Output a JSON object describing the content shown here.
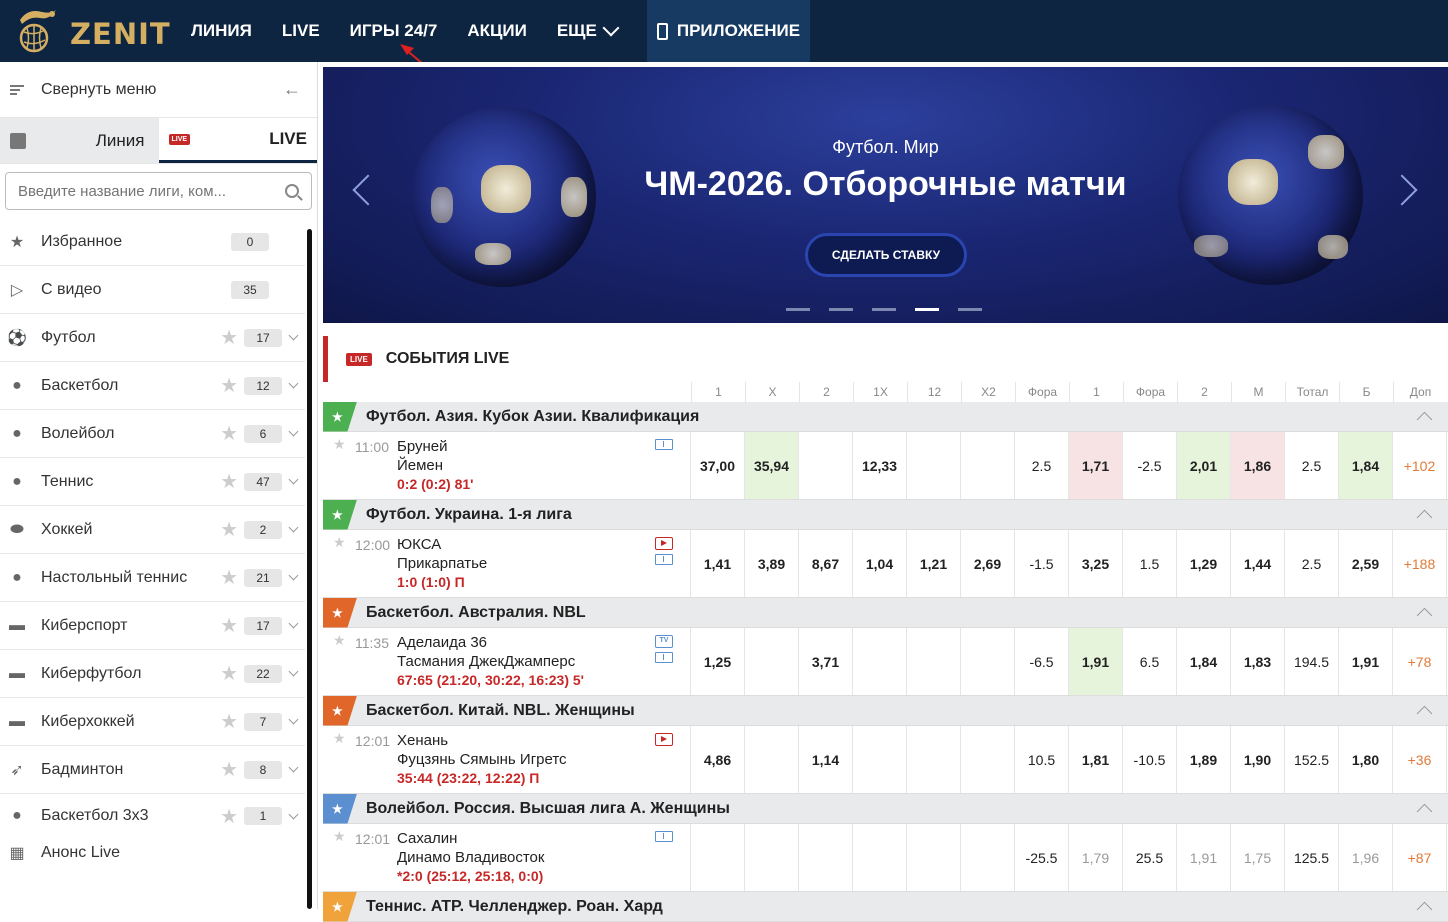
{
  "header": {
    "logo_text": "ZENIT",
    "nav": [
      "ЛИНИЯ",
      "LIVE",
      "ИГРЫ 24/7",
      "АКЦИИ",
      "ЕЩЕ"
    ],
    "app_label": "ПРИЛОЖЕНИЕ"
  },
  "sidebar": {
    "collapse_label": "Свернуть меню",
    "tab_line": "Линия",
    "tab_live": "LIVE",
    "live_badge": "LIVE",
    "search_placeholder": "Введите название лиги, ком...",
    "sports": [
      {
        "name": "Избранное",
        "count": "0",
        "icon": "star-icon"
      },
      {
        "name": "С видео",
        "count": "35",
        "icon": "video-icon"
      },
      {
        "name": "Футбол",
        "count": "17",
        "icon": "football-icon"
      },
      {
        "name": "Баскетбол",
        "count": "12",
        "icon": "basketball-icon"
      },
      {
        "name": "Волейбол",
        "count": "6",
        "icon": "volleyball-icon"
      },
      {
        "name": "Теннис",
        "count": "47",
        "icon": "tennis-icon"
      },
      {
        "name": "Хоккей",
        "count": "2",
        "icon": "hockey-icon"
      },
      {
        "name": "Настольный теннис",
        "count": "21",
        "icon": "table-tennis-icon"
      },
      {
        "name": "Киберспорт",
        "count": "17",
        "icon": "gamepad-icon"
      },
      {
        "name": "Киберфутбол",
        "count": "22",
        "icon": "gamepad-icon"
      },
      {
        "name": "Киберхоккей",
        "count": "7",
        "icon": "gamepad-icon"
      },
      {
        "name": "Бадминтон",
        "count": "8",
        "icon": "shuttlecock-icon"
      },
      {
        "name": "Баскетбол 3х3",
        "count": "1",
        "icon": "basketball-3x3-icon"
      }
    ],
    "announce": "Анонс Live"
  },
  "banner": {
    "category": "Футбол. Мир",
    "title": "ЧМ-2026. Отборочные матчи",
    "button": "СДЕЛАТЬ СТАВКУ",
    "active_slide": 4,
    "slides": 5
  },
  "events": {
    "live_badge": "LIVE",
    "title": "СОБЫТИЯ LIVE",
    "columns": [
      "1",
      "Х",
      "2",
      "1Х",
      "12",
      "Х2",
      "Фора",
      "1",
      "Фора",
      "2",
      "М",
      "Тотал",
      "Б",
      "Доп"
    ],
    "leagues": [
      {
        "name": "Футбол. Азия. Кубок Азии. Квалификация",
        "color": "#4caf50",
        "match": {
          "time": "11:00",
          "team1": "Бруней",
          "team2": "Йемен",
          "score": "0:2 (0:2) 81'",
          "odds": [
            "37,00",
            "35,94",
            "",
            "12,33",
            "",
            "",
            "2.5",
            "1,71",
            "-2.5",
            "2,01",
            "1,86",
            "2.5",
            "1,84",
            "+102"
          ]
        }
      },
      {
        "name": "Футбол. Украина. 1-я лига",
        "color": "#4caf50",
        "match": {
          "time": "12:00",
          "team1": "ЮКСА",
          "team2": "Прикарпатье",
          "score": "1:0 (1:0) П",
          "odds": [
            "1,41",
            "3,89",
            "8,67",
            "1,04",
            "1,21",
            "2,69",
            "-1.5",
            "3,25",
            "1.5",
            "1,29",
            "1,44",
            "2.5",
            "2,59",
            "+188"
          ]
        }
      },
      {
        "name": "Баскетбол. Австралия. NBL",
        "color": "#e0662a",
        "match": {
          "time": "11:35",
          "team1": "Аделаида 36",
          "team2": "Тасмания ДжекДжамперс",
          "score": "67:65 (21:20, 30:22, 16:23) 5'",
          "odds": [
            "1,25",
            "",
            "3,71",
            "",
            "",
            "",
            "-6.5",
            "1,91",
            "6.5",
            "1,84",
            "1,83",
            "194.5",
            "1,91",
            "+78"
          ]
        }
      },
      {
        "name": "Баскетбол. Китай. NBL. Женщины",
        "color": "#e0662a",
        "match": {
          "time": "12:01",
          "team1": "Хенань",
          "team2": "Фуцзянь Сямынь Игретс",
          "score": "35:44 (23:22, 12:22) П",
          "odds": [
            "4,86",
            "",
            "1,14",
            "",
            "",
            "",
            "10.5",
            "1,81",
            "-10.5",
            "1,89",
            "1,90",
            "152.5",
            "1,80",
            "+36"
          ]
        }
      },
      {
        "name": "Волейбол. Россия. Высшая лига А. Женщины",
        "color": "#5b8fd0",
        "match": {
          "time": "12:01",
          "team1": "Сахалин",
          "team2": "Динамо Владивосток",
          "score": "*2:0 (25:12, 25:18, 0:0)",
          "odds": [
            "",
            "",
            "",
            "",
            "",
            "",
            "-25.5",
            "1,79",
            "25.5",
            "1,91",
            "1,75",
            "125.5",
            "1,96",
            "+87"
          ]
        }
      },
      {
        "name": "Теннис. ATP. Челленджер. Роан. Хард",
        "color": "#f0a33a"
      }
    ]
  }
}
